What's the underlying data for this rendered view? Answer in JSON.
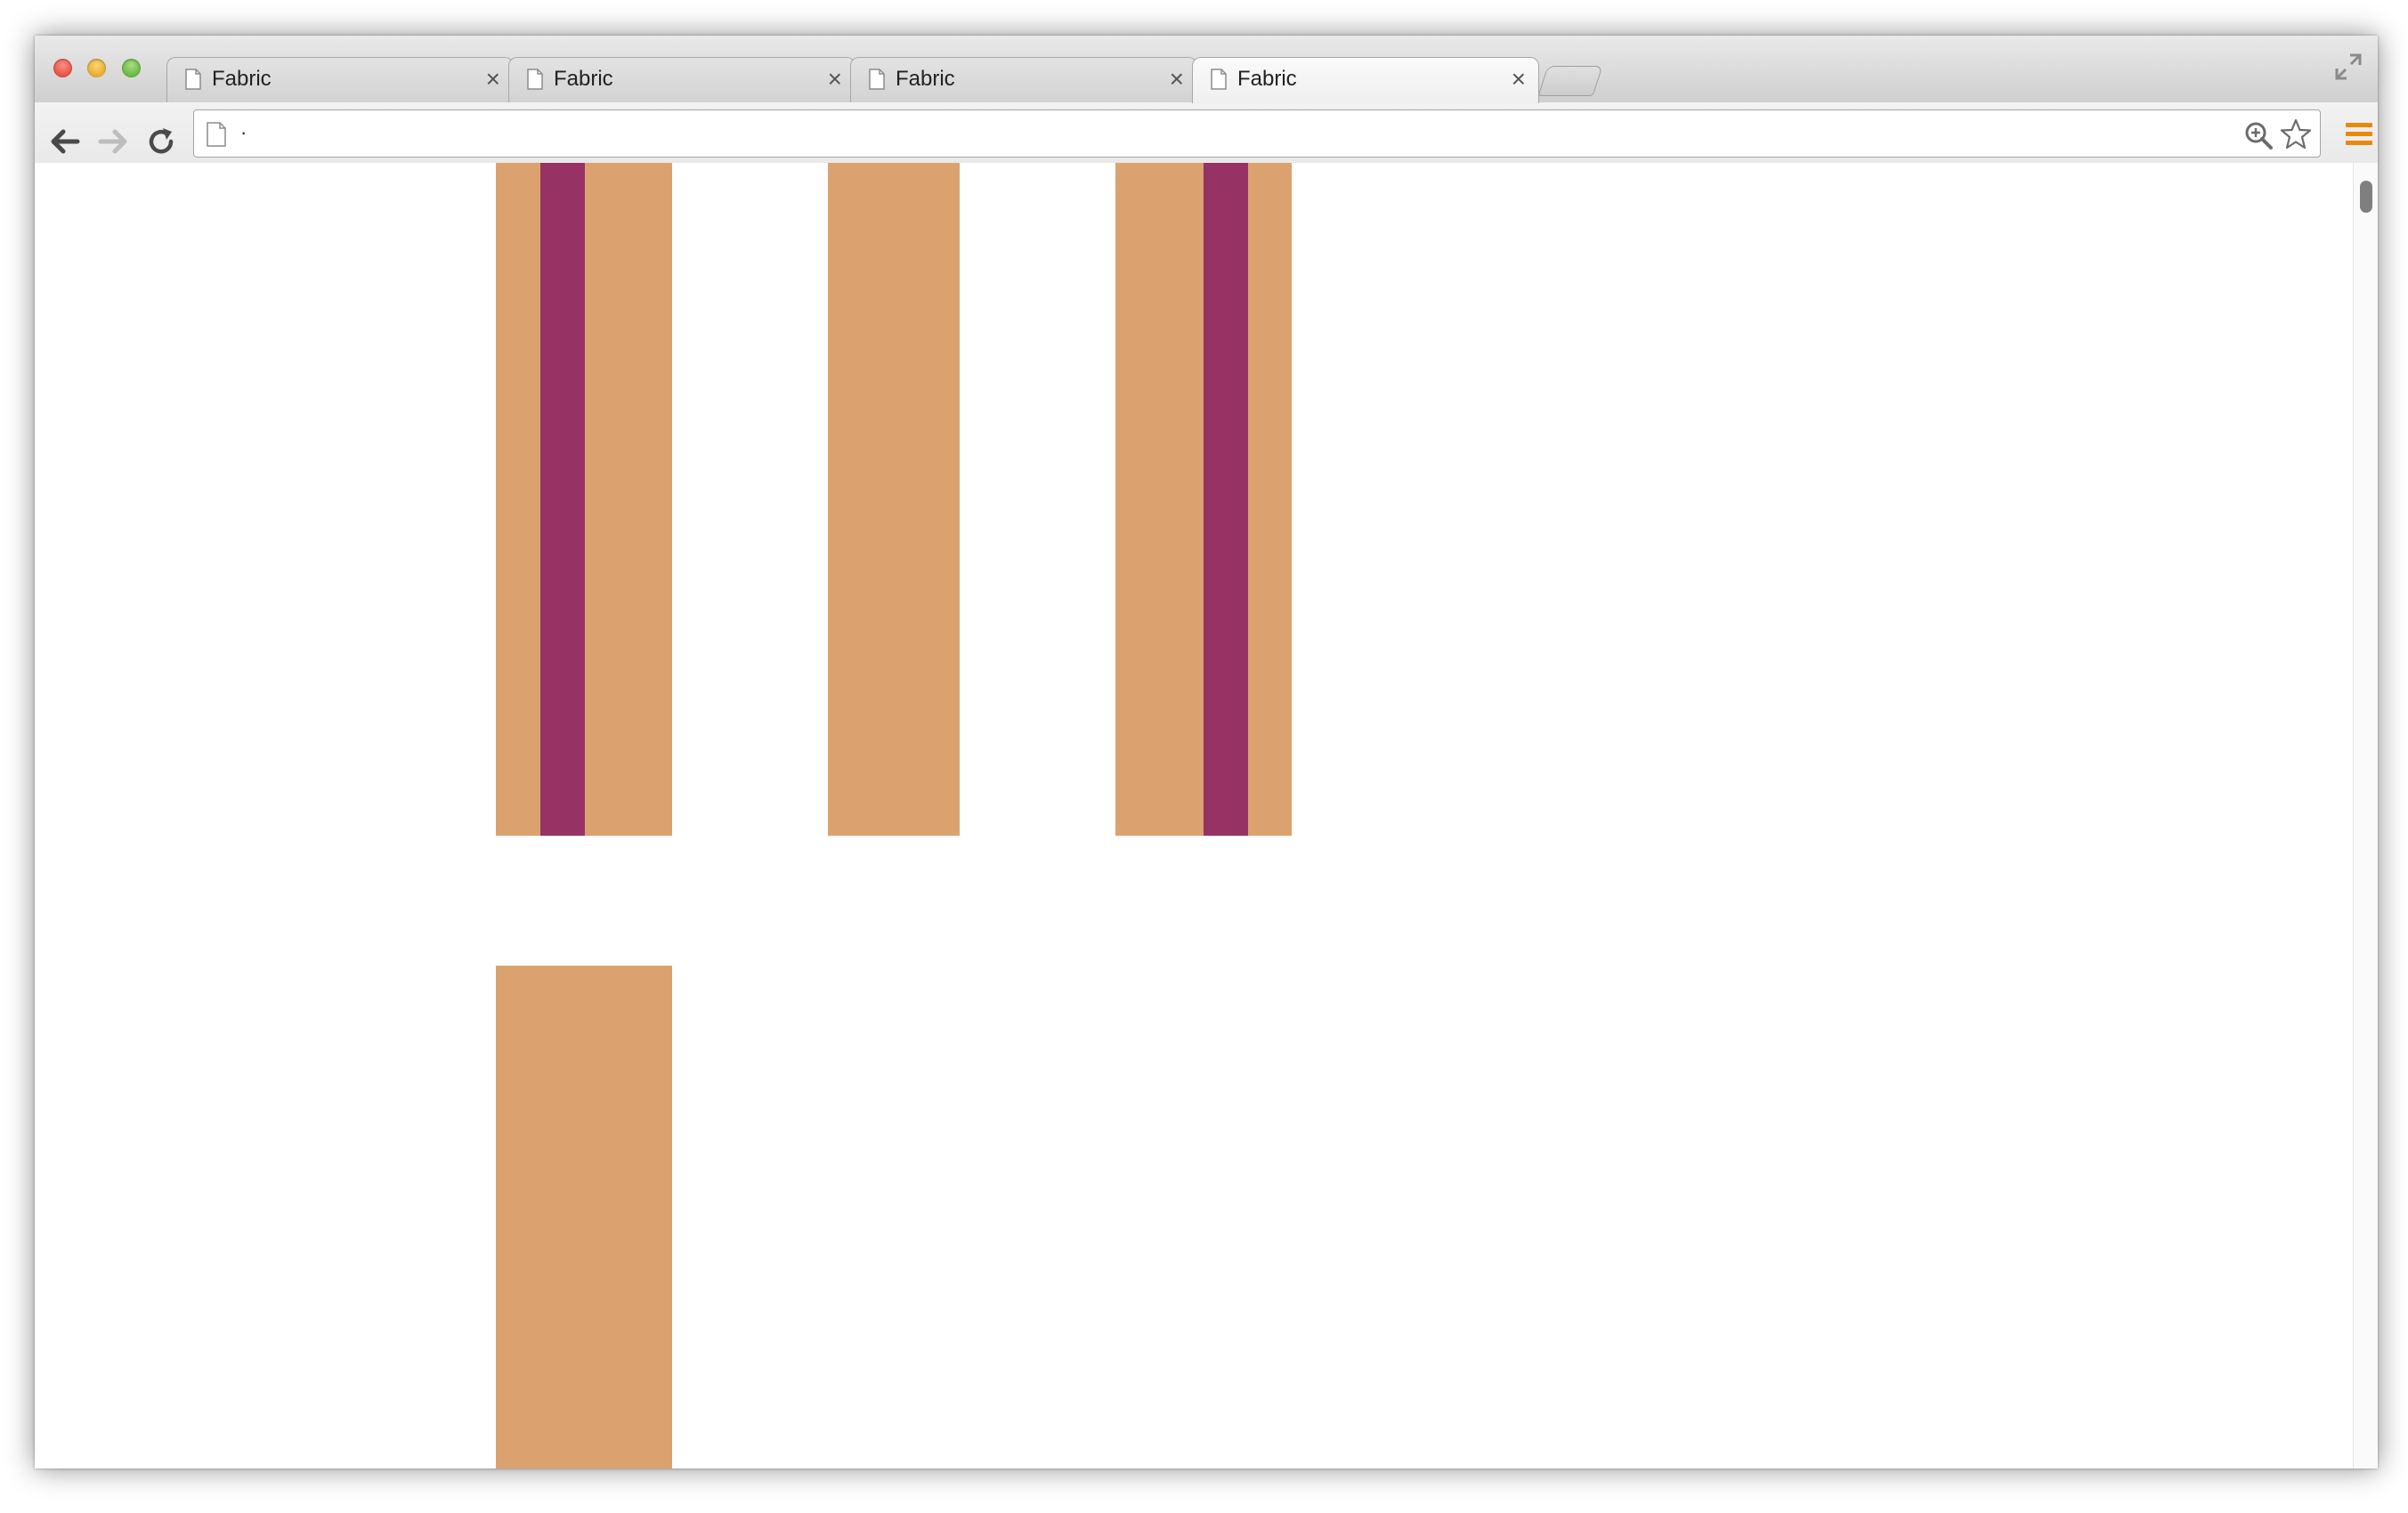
{
  "browser": {
    "tabs": [
      {
        "title": "Fabric",
        "close": "×",
        "active": false
      },
      {
        "title": "Fabric",
        "close": "×",
        "active": false
      },
      {
        "title": "Fabric",
        "close": "×",
        "active": false
      },
      {
        "title": "Fabric",
        "close": "×",
        "active": true
      }
    ],
    "url": "·"
  },
  "colors": {
    "tan": "#dba26f",
    "plum": "#963264"
  }
}
